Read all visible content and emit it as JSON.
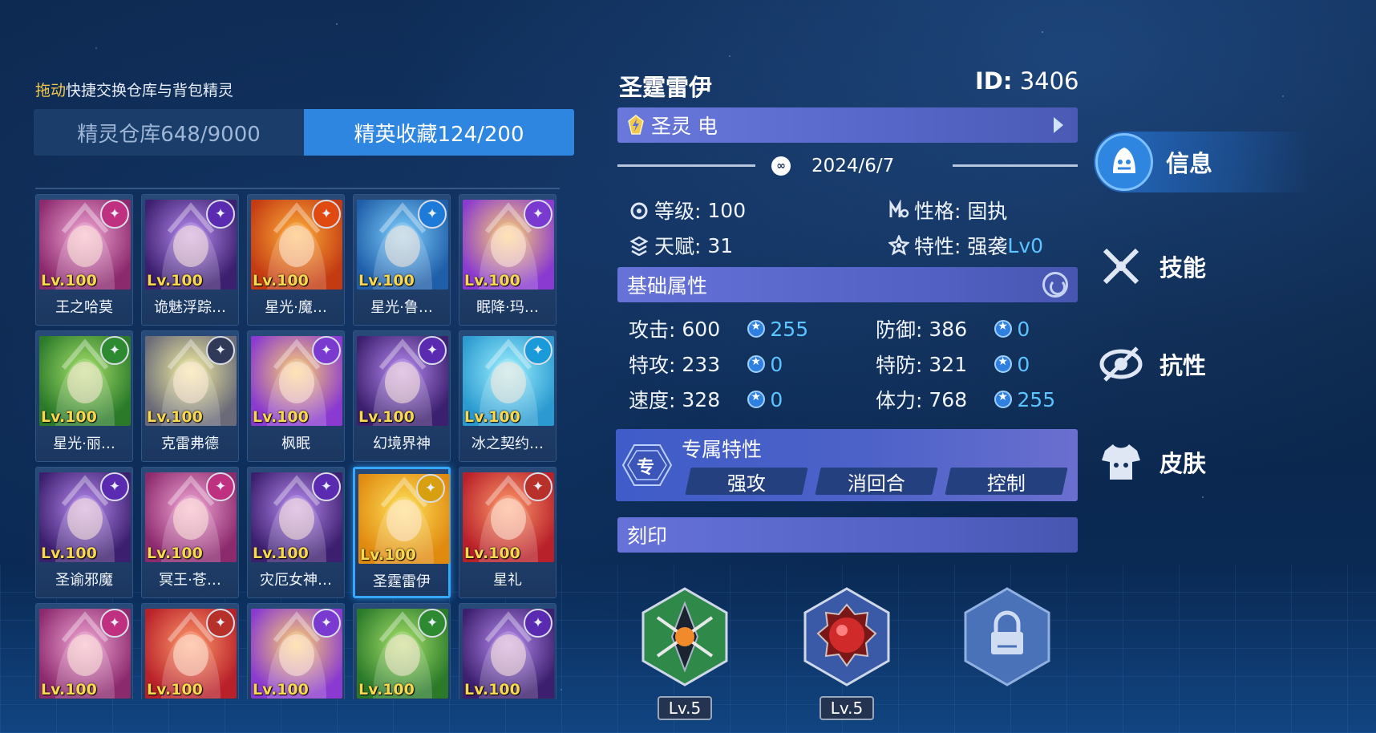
{
  "hint": {
    "highlight": "拖动",
    "text": "快捷交换仓库与背包精灵"
  },
  "tabs": [
    {
      "label": "精灵仓库648/9000",
      "active": false
    },
    {
      "label": "精英收藏124/200",
      "active": true
    }
  ],
  "cards": [
    {
      "level": "Lv.100",
      "name": "王之哈莫",
      "element": "pink",
      "icon": "dragon-element-icon"
    },
    {
      "level": "Lv.100",
      "name": "诡魅浮踪…",
      "element": "purple",
      "icon": "shadow-element-icon"
    },
    {
      "level": "Lv.100",
      "name": "星光·魔…",
      "element": "fire",
      "icon": "fire-element-icon"
    },
    {
      "level": "Lv.100",
      "name": "星光·鲁…",
      "element": "water",
      "icon": "water-element-icon"
    },
    {
      "level": "Lv.100",
      "name": "眠降·玛…",
      "element": "mixed",
      "icon": "dual-element-icon"
    },
    {
      "level": "Lv.100",
      "name": "星光·丽…",
      "element": "grass",
      "icon": "grass-element-icon"
    },
    {
      "level": "Lv.100",
      "name": "克雷弗德",
      "element": "electric",
      "icon": "electric-element-icon"
    },
    {
      "level": "Lv.100",
      "name": "枫眠",
      "element": "mixed",
      "icon": "dual-element-icon"
    },
    {
      "level": "Lv.100",
      "name": "幻境界神",
      "element": "purple",
      "icon": "illusion-element-icon"
    },
    {
      "level": "Lv.100",
      "name": "冰之契约…",
      "element": "ice",
      "icon": "ice-element-icon"
    },
    {
      "level": "Lv.100",
      "name": "圣谕邪魔",
      "element": "purple",
      "icon": "demon-element-icon"
    },
    {
      "level": "Lv.100",
      "name": "冥王·苍…",
      "element": "pink",
      "icon": "spirit-element-icon"
    },
    {
      "level": "Lv.100",
      "name": "灾厄女神…",
      "element": "purple",
      "icon": "chaos-element-icon"
    },
    {
      "level": "Lv.100",
      "name": "圣霆雷伊",
      "element": "holy",
      "icon": "holy-electric-element-icon",
      "selected": true
    },
    {
      "level": "Lv.100",
      "name": "星礼",
      "element": "red",
      "icon": "mixed-element-icon"
    },
    {
      "level": "Lv.100",
      "name": "",
      "element": "pink",
      "icon": "spirit-element-icon"
    },
    {
      "level": "Lv.100",
      "name": "",
      "element": "red",
      "icon": "mixed-element-icon"
    },
    {
      "level": "Lv.100",
      "name": "",
      "element": "mixed",
      "icon": "dual-element-icon"
    },
    {
      "level": "Lv.100",
      "name": "",
      "element": "grass",
      "icon": "grass-element-icon"
    },
    {
      "level": "Lv.100",
      "name": "",
      "element": "purple",
      "icon": "shadow-element-icon"
    }
  ],
  "pet": {
    "name": "圣霆雷伊",
    "id_label": "ID:",
    "id_value": "3406",
    "attribute": "圣灵 电",
    "date": "2024/6/7",
    "level_label": "等级:",
    "level": "100",
    "nature_label": "性格:",
    "nature": "固执",
    "talent_label": "天赋:",
    "talent": "31",
    "trait_label": "特性:",
    "trait": "强袭",
    "trait_level": "Lv0"
  },
  "base_stats": {
    "title": "基础属性",
    "rows": [
      {
        "name": "攻击:",
        "value": "600",
        "ev": "255"
      },
      {
        "name": "防御:",
        "value": "386",
        "ev": "0"
      },
      {
        "name": "特攻:",
        "value": "233",
        "ev": "0"
      },
      {
        "name": "特防:",
        "value": "321",
        "ev": "0"
      },
      {
        "name": "速度:",
        "value": "328",
        "ev": "0"
      },
      {
        "name": "体力:",
        "value": "768",
        "ev": "255"
      }
    ]
  },
  "exclusive": {
    "title": "专属特性",
    "badge": "专",
    "buttons": [
      "强攻",
      "消回合",
      "控制"
    ]
  },
  "seal": {
    "title": "刻印"
  },
  "equipment": [
    {
      "name": "soul-mark",
      "level": "Lv.5",
      "color": "#2f8a4a"
    },
    {
      "name": "red-gem",
      "level": "Lv.5",
      "color": "#3a5aa8"
    },
    {
      "name": "locked-slot",
      "level": "",
      "color": "#4a72b8"
    }
  ],
  "nav": [
    {
      "label": "信息",
      "active": true
    },
    {
      "label": "技能",
      "active": false
    },
    {
      "label": "抗性",
      "active": false
    },
    {
      "label": "皮肤",
      "active": false
    }
  ],
  "colors": {
    "accent": "#2f86e0",
    "level_text": "#f8d84e",
    "ev_blue": "#5cc4ff",
    "section_purple": "#5a68cc"
  }
}
